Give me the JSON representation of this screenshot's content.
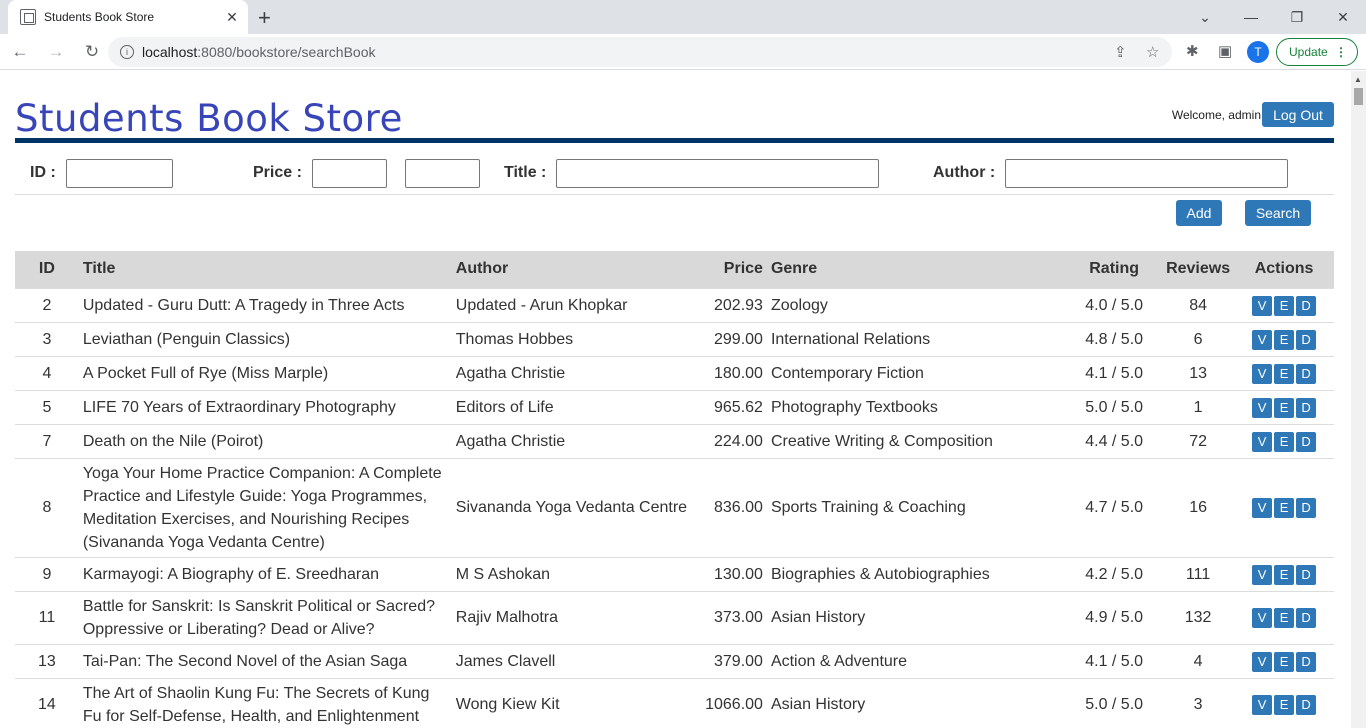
{
  "browser": {
    "tab_title": "Students Book Store",
    "url_host": "localhost",
    "url_rest": ":8080/bookstore/searchBook",
    "profile_initial": "T",
    "update_label": "Update"
  },
  "header": {
    "brand": "Students Book Store",
    "welcome": "Welcome, admin",
    "logout_label": "Log Out"
  },
  "search": {
    "id_label": "ID :",
    "price_label": "Price :",
    "title_label": "Title :",
    "author_label": "Author :",
    "add_label": "Add",
    "search_label": "Search"
  },
  "table": {
    "columns": [
      "ID",
      "Title",
      "Author",
      "Price",
      "Genre",
      "Rating",
      "Reviews",
      "Actions"
    ],
    "action_labels": [
      "V",
      "E",
      "D"
    ],
    "rows": [
      {
        "id": "2",
        "title": "Updated - Guru Dutt: A Tragedy in Three Acts",
        "author": "Updated - Arun Khopkar",
        "price": "202.93",
        "genre": "Zoology",
        "rating": "4.0 / 5.0",
        "reviews": "84"
      },
      {
        "id": "3",
        "title": "Leviathan (Penguin Classics)",
        "author": "Thomas Hobbes",
        "price": "299.00",
        "genre": "International Relations",
        "rating": "4.8 / 5.0",
        "reviews": "6"
      },
      {
        "id": "4",
        "title": "A Pocket Full of Rye (Miss Marple)",
        "author": "Agatha Christie",
        "price": "180.00",
        "genre": "Contemporary Fiction",
        "rating": "4.1 / 5.0",
        "reviews": "13"
      },
      {
        "id": "5",
        "title": "LIFE 70 Years of Extraordinary Photography",
        "author": "Editors of Life",
        "price": "965.62",
        "genre": "Photography Textbooks",
        "rating": "5.0 / 5.0",
        "reviews": "1"
      },
      {
        "id": "7",
        "title": "Death on the Nile (Poirot)",
        "author": "Agatha Christie",
        "price": "224.00",
        "genre": "Creative Writing & Composition",
        "rating": "4.4 / 5.0",
        "reviews": "72"
      },
      {
        "id": "8",
        "title": "Yoga Your Home Practice Companion: A Complete Practice and Lifestyle Guide: Yoga Programmes, Meditation Exercises, and Nourishing Recipes (Sivananda Yoga Vedanta Centre)",
        "author": "Sivananda Yoga Vedanta Centre",
        "price": "836.00",
        "genre": "Sports Training & Coaching",
        "rating": "4.7 / 5.0",
        "reviews": "16"
      },
      {
        "id": "9",
        "title": "Karmayogi: A Biography of E. Sreedharan",
        "author": "M S Ashokan",
        "price": "130.00",
        "genre": "Biographies & Autobiographies",
        "rating": "4.2 / 5.0",
        "reviews": "111"
      },
      {
        "id": "11",
        "title": "Battle for Sanskrit: Is Sanskrit Political or Sacred? Oppressive or Liberating? Dead or Alive?",
        "author": "Rajiv Malhotra",
        "price": "373.00",
        "genre": "Asian History",
        "rating": "4.9 / 5.0",
        "reviews": "132"
      },
      {
        "id": "13",
        "title": "Tai-Pan: The Second Novel of the Asian Saga",
        "author": "James Clavell",
        "price": "379.00",
        "genre": "Action & Adventure",
        "rating": "4.1 / 5.0",
        "reviews": "4"
      },
      {
        "id": "14",
        "title": "The Art of Shaolin Kung Fu: The Secrets of Kung Fu for Self-Defense, Health, and Enlightenment",
        "author": "Wong Kiew Kit",
        "price": "1066.00",
        "genre": "Asian History",
        "rating": "5.0 / 5.0",
        "reviews": "3"
      }
    ]
  }
}
